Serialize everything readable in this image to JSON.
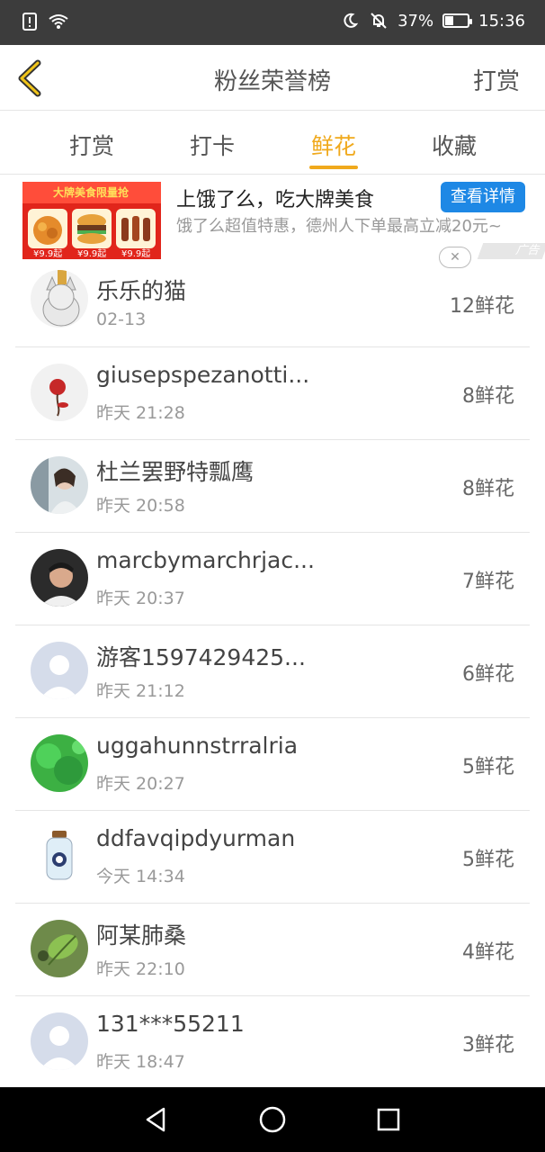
{
  "status_bar": {
    "battery": "37%",
    "time": "15:36",
    "icons": [
      "sim-alert-icon",
      "wifi-icon",
      "moon-icon",
      "bell-off-icon",
      "battery-icon"
    ],
    "battery_level": 0.37,
    "text_color": "#ffffff"
  },
  "header": {
    "title": "粉丝荣誉榜",
    "action": "打赏",
    "back_icon": "chevron-left-icon",
    "accent": "#f0a91c"
  },
  "tabs": [
    {
      "label": "打赏",
      "active": false
    },
    {
      "label": "打卡",
      "active": false
    },
    {
      "label": "鲜花",
      "active": true
    },
    {
      "label": "收藏",
      "active": false
    }
  ],
  "ad": {
    "image_banner": "大牌美食限量抢",
    "prices": [
      "¥9.9起",
      "¥9.9起",
      "¥9.9起"
    ],
    "title": "上饿了么，吃大牌美食",
    "button": "查看详情",
    "description": "饿了么超值特惠，德州人下单最高立减20元~",
    "close_label": "✕",
    "tag": "广告",
    "button_color": "#1e88e5"
  },
  "list": [
    {
      "name": "乐乐的猫",
      "time": "02-13",
      "count": "12鲜花",
      "avatar": "cat-avatar"
    },
    {
      "name": "giusepspezanotti...",
      "time": "昨天 21:28",
      "count": "8鲜花",
      "avatar": "flower-avatar"
    },
    {
      "name": "杜兰罢野特瓢鹰",
      "time": "昨天 20:58",
      "count": "8鲜花",
      "avatar": "person-avatar"
    },
    {
      "name": "marcbymarchrjac...",
      "time": "昨天 20:37",
      "count": "7鲜花",
      "avatar": "man-avatar"
    },
    {
      "name": "游客1597429425...",
      "time": "昨天 21:12",
      "count": "6鲜花",
      "avatar": "default-avatar"
    },
    {
      "name": "uggahunnstrralria",
      "time": "昨天 20:27",
      "count": "5鲜花",
      "avatar": "green-avatar"
    },
    {
      "name": "ddfavqipdyurman",
      "time": "今天 14:34",
      "count": "5鲜花",
      "avatar": "bottle-avatar"
    },
    {
      "name": "阿某肺桑",
      "time": "昨天 22:10",
      "count": "4鲜花",
      "avatar": "leaf-avatar"
    },
    {
      "name": "131***55211",
      "time": "昨天 18:47",
      "count": "3鲜花",
      "avatar": "default-avatar"
    }
  ],
  "nav_bar": {
    "icons": [
      "back-triangle-icon",
      "home-circle-icon",
      "recents-square-icon"
    ]
  }
}
